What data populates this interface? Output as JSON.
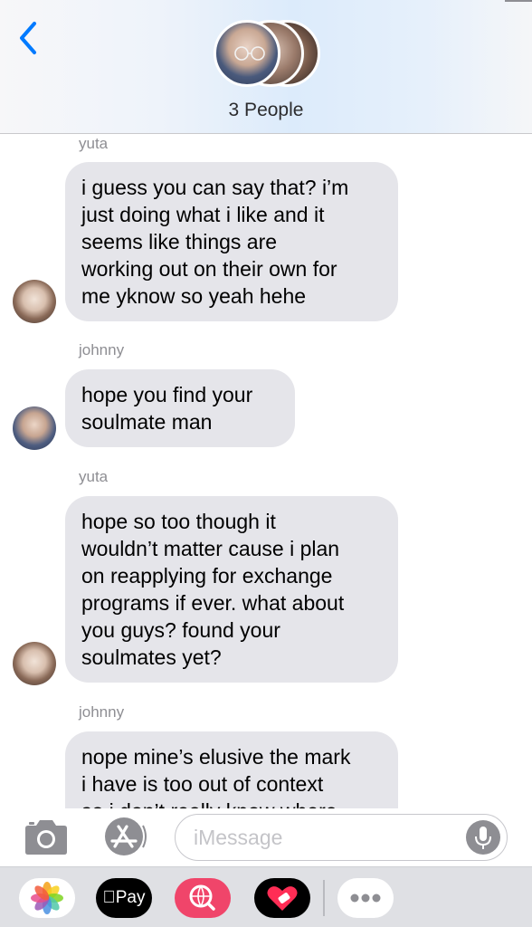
{
  "header": {
    "title": "3 People",
    "back_icon": "chevron-left-icon"
  },
  "messages": [
    {
      "sender": "yuta",
      "lines": [
        "i guess you can say that? i’m",
        "just doing what i like and it",
        "seems like things are",
        "working out on their own for",
        "me yknow so yeah hehe"
      ]
    },
    {
      "sender": "johnny",
      "lines": [
        "hope you find your",
        "soulmate man"
      ]
    },
    {
      "sender": "yuta",
      "lines": [
        "hope so too though it",
        "wouldn’t matter cause i plan",
        "on reapplying for exchange",
        "programs if ever. what about",
        "you guys? found your",
        "soulmates yet?"
      ]
    },
    {
      "sender": "johnny",
      "lines": [
        "nope mine’s elusive the mark",
        "i have is too out of context",
        "so i don’t really know where"
      ]
    }
  ],
  "composer": {
    "placeholder": "iMessage",
    "camera_icon": "camera-icon",
    "apps_icon": "app-store-icon",
    "mic_icon": "microphone-icon"
  },
  "app_drawer": {
    "apps": [
      "photos-icon",
      "apple-pay-icon",
      "web-search-icon",
      "digital-touch-icon",
      "more-icon"
    ],
    "pay_label": "Pay"
  },
  "colors": {
    "accent": "#007aff",
    "bubble_gray": "#e5e5ea",
    "sender_gray": "#8e8e93"
  }
}
